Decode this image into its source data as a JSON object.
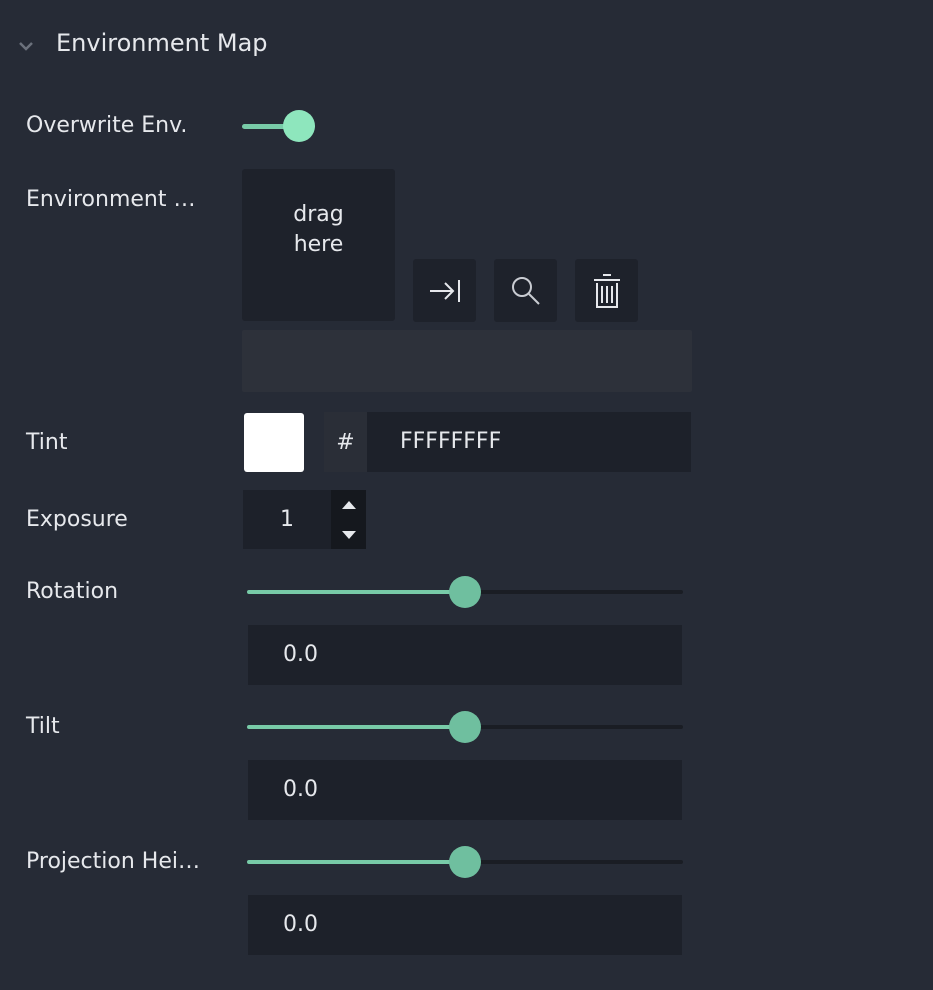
{
  "section": {
    "title": "Environment Map",
    "chevron_icon": "chevron-down-icon"
  },
  "overwrite": {
    "label": "Overwrite Env.",
    "enabled": true,
    "accent": "#8ee6bd"
  },
  "environment": {
    "label": "Environment …",
    "drop_text_line1": "drag",
    "drop_text_line2": "here",
    "buttons": [
      "assign-icon",
      "search-icon",
      "trash-icon"
    ],
    "path_value": ""
  },
  "tint": {
    "label": "Tint",
    "swatch_color": "#FFFFFF",
    "hash": "#",
    "hex_value": "FFFFFFFF"
  },
  "exposure": {
    "label": "Exposure",
    "value": "1"
  },
  "rotation": {
    "label": "Rotation",
    "slider_fraction": 0.5,
    "value": "0.0"
  },
  "tilt": {
    "label": "Tilt",
    "slider_fraction": 0.5,
    "value": "0.0"
  },
  "projection_height": {
    "label": "Projection Hei…",
    "slider_fraction": 0.5,
    "value": "0.0"
  }
}
